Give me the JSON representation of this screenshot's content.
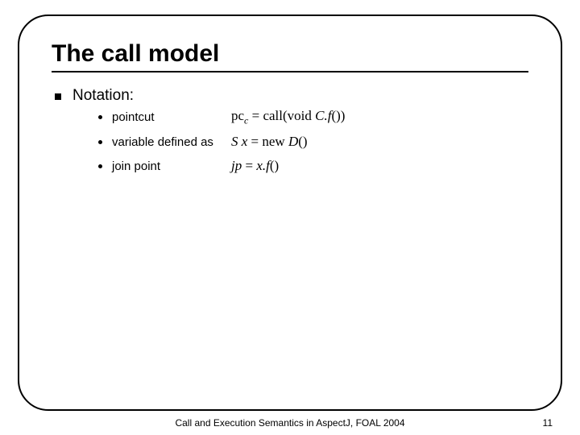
{
  "slide": {
    "title": "The call model",
    "notation_label": "Notation:",
    "items": [
      {
        "label": "pointcut",
        "formula_html": "<span class='rm'>pc</span><span class='sub'>c</span> <span class='rm'>=</span> <span class='rm'>call(void</span> C.f<span class='rm'>())</span>"
      },
      {
        "label": "variable defined as",
        "formula_html": "S x <span class='rm'>= new</span> D<span class='rm'>()</span>"
      },
      {
        "label": "join point",
        "formula_html": "jp <span class='rm'>=</span> x.f<span class='rm'>()</span>"
      }
    ]
  },
  "footer": {
    "text": "Call and Execution Semantics in AspectJ, FOAL 2004",
    "page": "11"
  }
}
